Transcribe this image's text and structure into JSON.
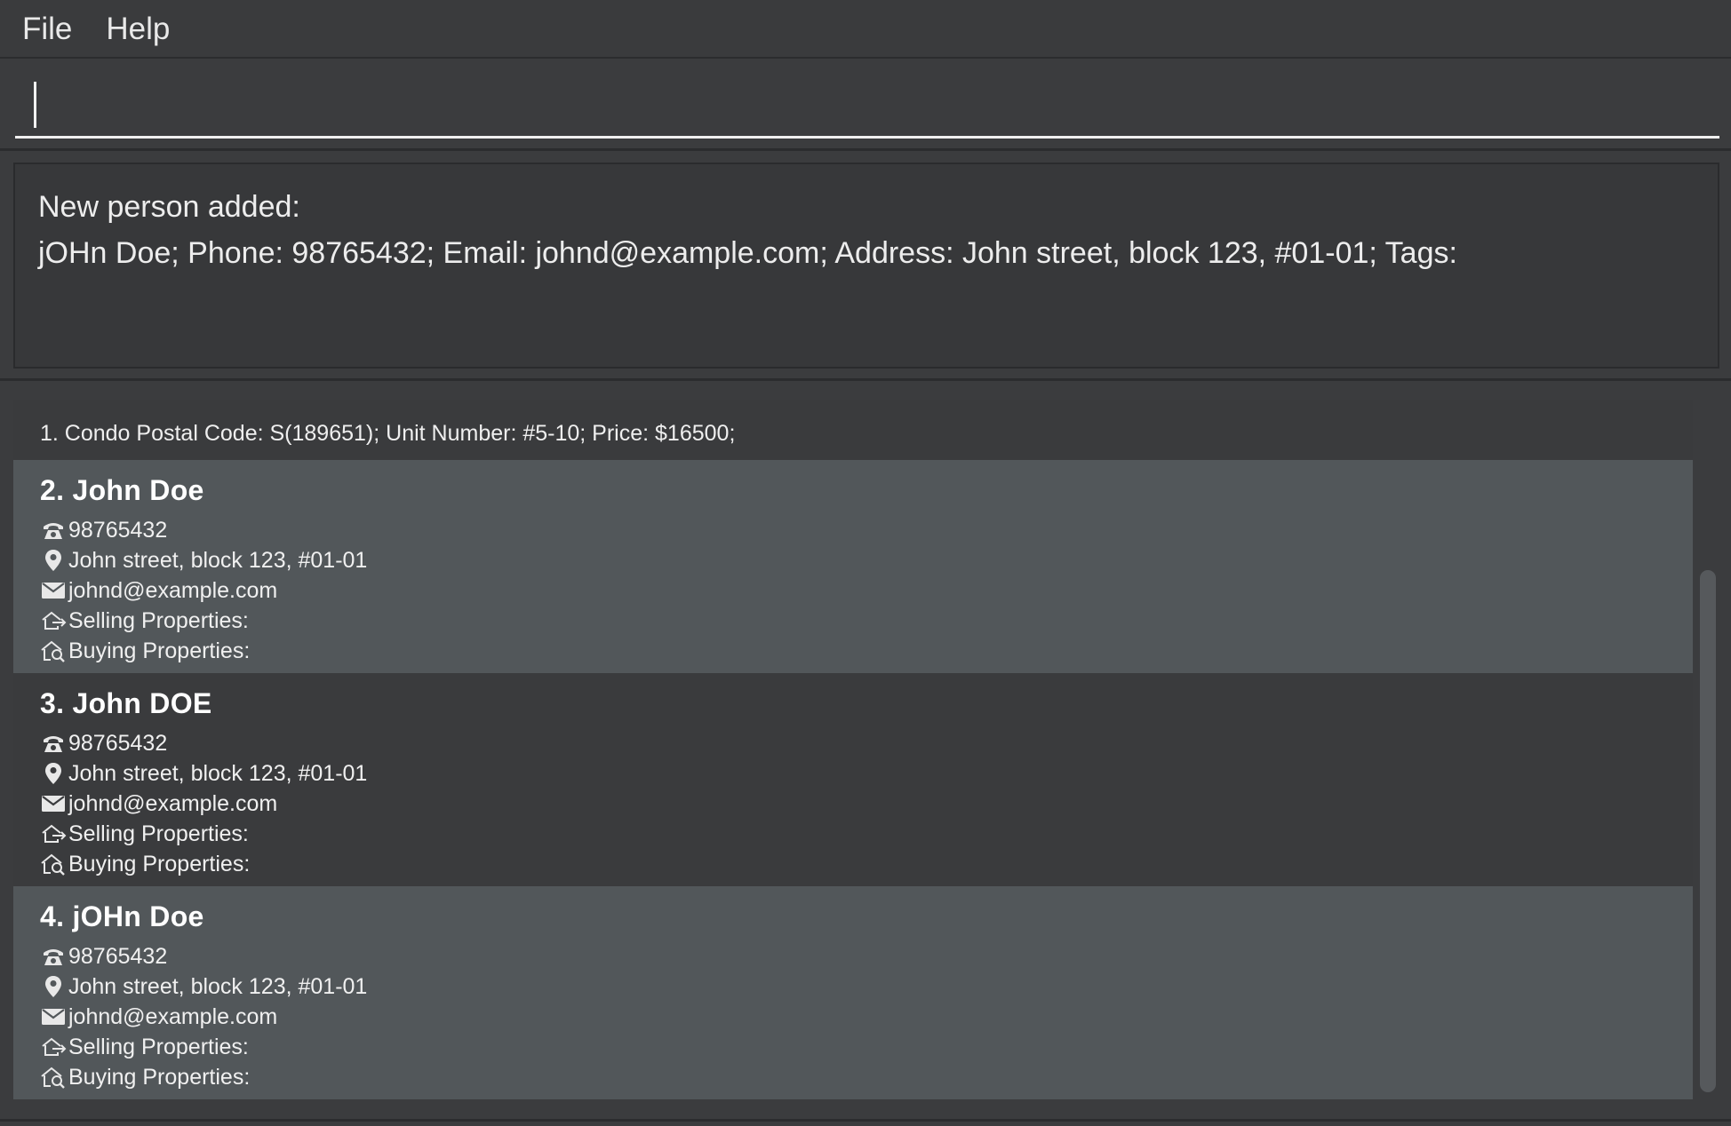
{
  "menu": {
    "file": "File",
    "help": "Help"
  },
  "command": {
    "value": "",
    "placeholder": ""
  },
  "result": {
    "line1": "New person added:",
    "line2": "jOHn Doe; Phone: 98765432; Email: johnd@example.com; Address: John street, block 123, #01-01; Tags:"
  },
  "list": {
    "property": {
      "text": "1. Condo Postal Code: S(189651);  Unit Number: #5-10;  Price: $16500;"
    },
    "persons": [
      {
        "title": "2. John Doe",
        "phone": "98765432",
        "address": "John street, block 123, #01-01",
        "email": "johnd@example.com",
        "selling": "Selling Properties:",
        "buying": "Buying Properties:"
      },
      {
        "title": "3. John DOE",
        "phone": "98765432",
        "address": "John street, block 123, #01-01",
        "email": "johnd@example.com",
        "selling": "Selling Properties:",
        "buying": "Buying Properties:"
      },
      {
        "title": "4. jOHn Doe",
        "phone": "98765432",
        "address": "John street, block 123, #01-01",
        "email": "johnd@example.com",
        "selling": "Selling Properties:",
        "buying": "Buying Properties:"
      }
    ]
  },
  "icons": {
    "phone": "phone-icon",
    "address": "location-pin-icon",
    "email": "envelope-icon",
    "selling": "house-out-icon",
    "buying": "house-search-icon"
  },
  "colors": {
    "background": "#3b3c3e",
    "card_light": "#52575a",
    "card_dark": "#3a3b3d",
    "text": "#ffffff"
  }
}
